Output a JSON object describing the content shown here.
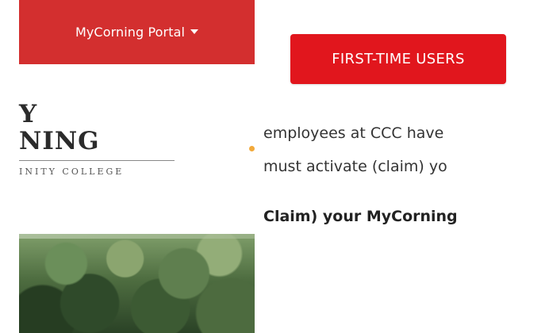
{
  "nav": {
    "portal_label": "MyCorning Portal"
  },
  "logo": {
    "line1": "Y",
    "line2": "NING",
    "line3": "INITY COLLEGE"
  },
  "main": {
    "first_time_button": "FIRST-TIME USERS",
    "text_line1": "employees at CCC have",
    "text_line2": "must activate (claim) yo",
    "text_line3": "Claim) your MyCorning"
  },
  "colors": {
    "portal_bar": "#d32f2f",
    "button_red": "#e1161d",
    "text": "#333333"
  },
  "icons": {
    "portal_caret": "caret-down-icon"
  }
}
